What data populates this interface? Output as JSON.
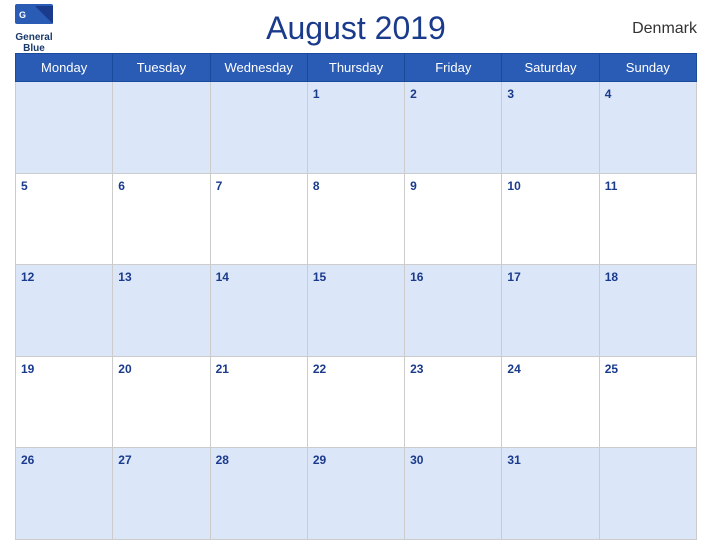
{
  "header": {
    "title": "August 2019",
    "country": "Denmark",
    "logo_line1": "General",
    "logo_line2": "Blue"
  },
  "days_of_week": [
    "Monday",
    "Tuesday",
    "Wednesday",
    "Thursday",
    "Friday",
    "Saturday",
    "Sunday"
  ],
  "weeks": [
    [
      null,
      null,
      null,
      1,
      2,
      3,
      4
    ],
    [
      5,
      6,
      7,
      8,
      9,
      10,
      11
    ],
    [
      12,
      13,
      14,
      15,
      16,
      17,
      18
    ],
    [
      19,
      20,
      21,
      22,
      23,
      24,
      25
    ],
    [
      26,
      27,
      28,
      29,
      30,
      31,
      null
    ]
  ]
}
